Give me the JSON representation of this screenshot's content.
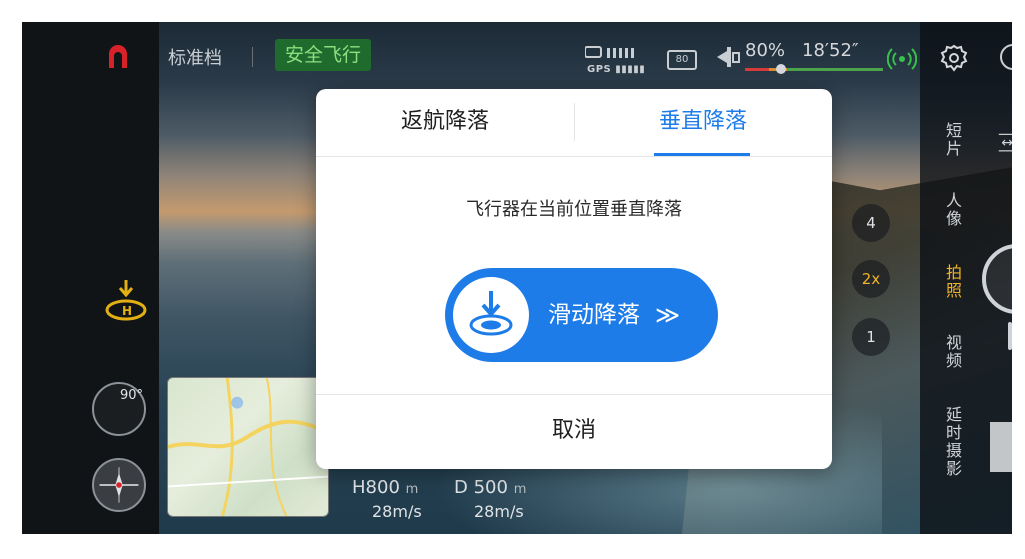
{
  "status_bar": {
    "mode": "标准档",
    "safety_badge": "安全飞行",
    "gps_label": "GPS",
    "battery_level": "80",
    "drone_battery_pct": "80%",
    "flight_time": "18′52″",
    "battery_bar_fraction": 1.0
  },
  "left_panel": {
    "attitude_angle": "90°",
    "compass_label": "N"
  },
  "telemetry": {
    "height_label": "H",
    "height_value": "800",
    "height_unit": "m",
    "distance_label": "D",
    "distance_value": "500",
    "distance_unit": "m",
    "vertical_speed": "28m/s",
    "horizontal_speed": "28m/s"
  },
  "camera_panel": {
    "zoom_options": [
      "4",
      "2x",
      "1"
    ],
    "zoom_selected": "2x",
    "modes": [
      "短片",
      "人像",
      "拍照",
      "视频",
      "延时摄影"
    ],
    "mode_selected": "拍照"
  },
  "dialog": {
    "tabs": [
      {
        "label": "返航降落",
        "active": false
      },
      {
        "label": "垂直降落",
        "active": true
      }
    ],
    "description": "飞行器在当前位置垂直降落",
    "slide_label": "滑动降落",
    "slide_arrows": "≫",
    "cancel_label": "取消"
  },
  "colors": {
    "accent": "#1e7ce8",
    "safety_green": "#8ae07e",
    "highlight_yellow": "#f0b429"
  },
  "icons": [
    "logo-icon",
    "signal-icon",
    "battery-icon",
    "drone-icon",
    "rc-signal-icon",
    "settings-icon",
    "landing-icon",
    "attitude-icon",
    "compass-icon",
    "land-slide-icon"
  ]
}
